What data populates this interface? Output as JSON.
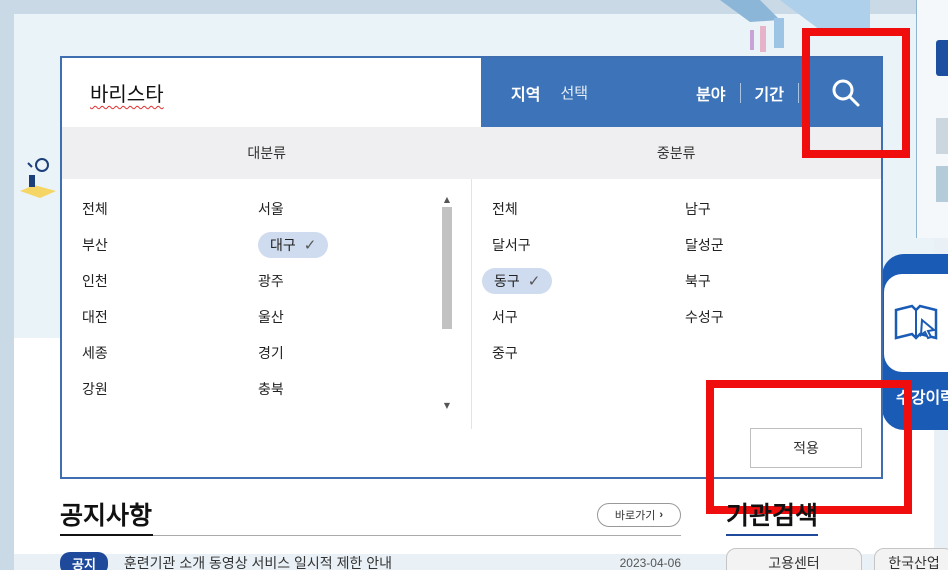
{
  "search": {
    "query": "바리스타",
    "region_label": "지역",
    "region_value": "선택",
    "field_label": "분야",
    "period_label": "기간"
  },
  "columns": {
    "major": "대분류",
    "minor": "중분류"
  },
  "major_items": [
    {
      "label": "전체",
      "selected": false
    },
    {
      "label": "서울",
      "selected": false
    },
    {
      "label": "부산",
      "selected": false
    },
    {
      "label": "대구",
      "selected": true
    },
    {
      "label": "인천",
      "selected": false
    },
    {
      "label": "광주",
      "selected": false
    },
    {
      "label": "대전",
      "selected": false
    },
    {
      "label": "울산",
      "selected": false
    },
    {
      "label": "세종",
      "selected": false
    },
    {
      "label": "경기",
      "selected": false
    },
    {
      "label": "강원",
      "selected": false
    },
    {
      "label": "충북",
      "selected": false
    }
  ],
  "minor_items": [
    {
      "label": "전체",
      "selected": false
    },
    {
      "label": "남구",
      "selected": false
    },
    {
      "label": "달서구",
      "selected": false
    },
    {
      "label": "달성군",
      "selected": false
    },
    {
      "label": "동구",
      "selected": true
    },
    {
      "label": "북구",
      "selected": false
    },
    {
      "label": "서구",
      "selected": false
    },
    {
      "label": "수성구",
      "selected": false
    },
    {
      "label": "중구",
      "selected": false
    }
  ],
  "apply_label": "적용",
  "notice": {
    "title": "공지사항",
    "goto_label": "바로가기",
    "badge": "공지",
    "text": "훈련기관 소개 동영상 서비스 일시적 제한 안내",
    "date": "2023-04-06"
  },
  "institution": {
    "title": "기관검색",
    "tab1": "고용센터",
    "tab2": "한국산업"
  },
  "side_card_label": "수강이력",
  "colors": {
    "primary_blue": "#3d74b9",
    "dark_blue": "#1f4a9c",
    "annotation_red": "#ef0d0d",
    "selected_chip": "#cfdbee"
  }
}
